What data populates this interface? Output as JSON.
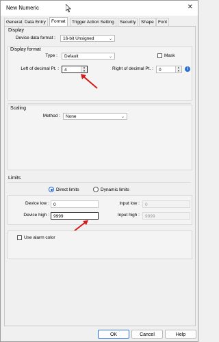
{
  "window": {
    "title": "New Numeric"
  },
  "tabs": [
    "General",
    "Data Entry",
    "Format",
    "Trigger Action Setting",
    "Security",
    "Shape",
    "Font"
  ],
  "active_tab": "Format",
  "display": {
    "section": "Display",
    "device_data_format_label": "Device data format :",
    "device_data_format_value": "16-bit Unsigned",
    "display_format_label": "Display format",
    "type_label": "Type :",
    "type_value": "Default",
    "mask_label": "Mask",
    "left_decimal_label": "Left of decimal Pt. :",
    "left_decimal_value": "4",
    "right_decimal_label": "Right of decimal Pt. :",
    "right_decimal_value": "0"
  },
  "scaling": {
    "section": "Scaling",
    "method_label": "Method :",
    "method_value": "None"
  },
  "limits": {
    "section": "Limits",
    "direct_label": "Direct limits",
    "dynamic_label": "Dynamic limits",
    "device_low_label": "Device low :",
    "device_low_value": "0",
    "input_low_label": "Input low :",
    "input_low_value": "0",
    "device_high_label": "Device high :",
    "device_high_value": "9999",
    "input_high_label": "Input high :",
    "input_high_value": "9999"
  },
  "alarm": {
    "label": "Use alarm color"
  },
  "buttons": {
    "ok": "OK",
    "cancel": "Cancel",
    "help": "Help"
  },
  "colors": {
    "accent": "#2a6fd6",
    "annotation_arrow": "#d41a1a"
  }
}
